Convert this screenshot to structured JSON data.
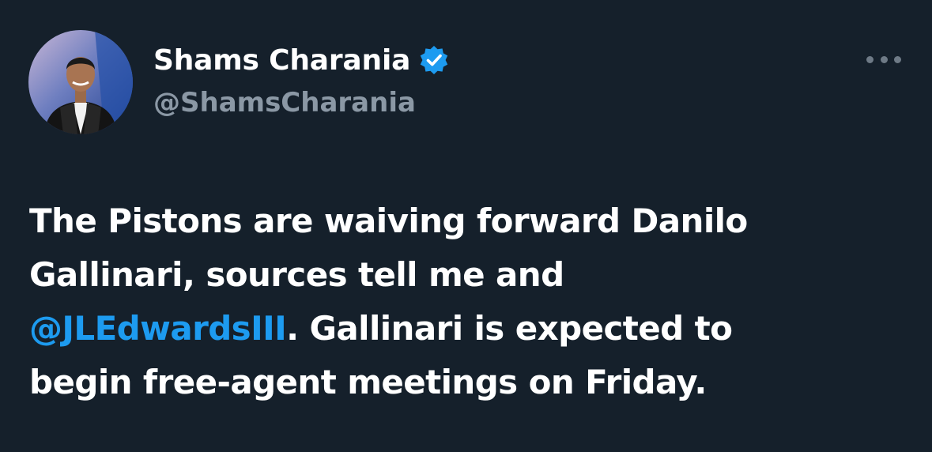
{
  "tweet": {
    "author": {
      "display_name": "Shams Charania",
      "handle": "@ShamsCharania",
      "verified": true,
      "verified_icon": "verified-badge-icon",
      "avatar_icon": "avatar-photo"
    },
    "more_icon": "more-options-icon",
    "text": {
      "line1": "The Pistons are waiving forward Danilo",
      "line2": "Gallinari, sources tell me and",
      "mention": "@JLEdwardsIII",
      "line3_rest": ". Gallinari is expected to",
      "line4": "begin free-agent meetings on Friday."
    }
  },
  "colors": {
    "background": "#15202b",
    "text_primary": "#ffffff",
    "text_secondary": "#8b98a5",
    "accent": "#1d9bf0"
  }
}
